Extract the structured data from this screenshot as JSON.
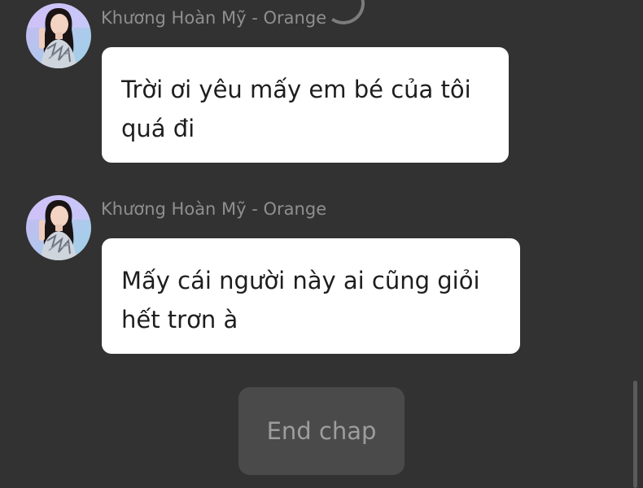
{
  "theme": {
    "background": "#323232",
    "bubble": "#ffffff",
    "sender_text": "#8f8f8f",
    "button_bg": "#4a4a4a",
    "button_text": "#9d9d9d"
  },
  "messages": [
    {
      "sender": "Khương Hoàn Mỹ - Orange",
      "avatar": "profile-photo",
      "lines": [
        "Trời ơi yêu mấy em bé của tôi",
        "quá đi"
      ]
    },
    {
      "sender": "Khương Hoàn Mỹ - Orange",
      "avatar": "profile-photo",
      "lines": [
        "Mấy cái người này ai cũng giỏi",
        "hết trơn à"
      ]
    }
  ],
  "end_button": {
    "label": "End chap"
  }
}
